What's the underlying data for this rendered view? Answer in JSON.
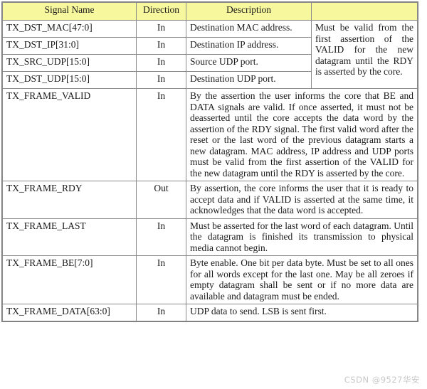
{
  "table": {
    "headers": {
      "signal_name": "Signal Name",
      "direction": "Direction",
      "description": "Description",
      "extra": ""
    },
    "colors": {
      "header_background": "#f7f79e",
      "border": "#8a8a8a",
      "text": "#1a1a1a",
      "watermark": "#c9c9c9",
      "page_background": "#ffffff"
    },
    "grouped_note": "Must be valid from the first assertion of the VALID for the new datagram until the RDY is asserted by the core.",
    "rows": [
      {
        "signal_name": "TX_DST_MAC[47:0]",
        "direction": "In",
        "description": "Destination MAC address.",
        "spans_description": false
      },
      {
        "signal_name": "TX_DST_IP[31:0]",
        "direction": "In",
        "description": "Destination IP address.",
        "spans_description": false
      },
      {
        "signal_name": "TX_SRC_UDP[15:0]",
        "direction": "In",
        "description": "Source UDP port.",
        "spans_description": false
      },
      {
        "signal_name": "TX_DST_UDP[15:0]",
        "direction": "In",
        "description": "Destination UDP port.",
        "spans_description": false
      },
      {
        "signal_name": "TX_FRAME_VALID",
        "direction": "In",
        "description": "By the assertion the user informs the core that BE and DATA signals are valid. If once asserted, it must not be deasserted until the core accepts the data word by the assertion of the RDY signal. The first valid word after the reset or the last word of the previous datagram starts a new datagram. MAC address, IP address and UDP ports must be valid from the first assertion of the VALID for the new datagram until the RDY is asserted by the core.",
        "spans_description": true
      },
      {
        "signal_name": "TX_FRAME_RDY",
        "direction": "Out",
        "description": "By assertion, the core informs the user that it is ready to accept data and if VALID is asserted at the same time, it acknowledges that the data word is accepted.",
        "spans_description": true
      },
      {
        "signal_name": "TX_FRAME_LAST",
        "direction": "In",
        "description": "Must be asserted for the last word of each datagram. Until the datagram is finished its transmission to physical media cannot begin.",
        "spans_description": true
      },
      {
        "signal_name": "TX_FRAME_BE[7:0]",
        "direction": "In",
        "description": "Byte enable. One bit per data byte. Must be set to all ones for all words except for the last one. May be all zeroes if empty datagram shall be sent or if no more data are available and datagram must be ended.",
        "spans_description": true
      },
      {
        "signal_name": "TX_FRAME_DATA[63:0]",
        "direction": "In",
        "description": "UDP data to send. LSB is sent first.",
        "spans_description": true
      }
    ]
  },
  "watermark": {
    "text": "CSDN @9527华安"
  }
}
